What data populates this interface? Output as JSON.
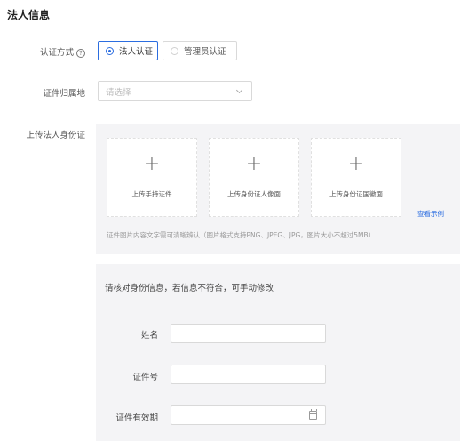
{
  "section": {
    "title": "法人信息"
  },
  "auth_method": {
    "label": "认证方式",
    "help_icon_glyph": "?",
    "options": [
      {
        "label": "法人认证",
        "selected": true
      },
      {
        "label": "管理员认证",
        "selected": false
      }
    ]
  },
  "id_region": {
    "label": "证件归属地",
    "placeholder": "请选择"
  },
  "id_upload": {
    "label": "上传法人身份证",
    "plus_glyph": "+",
    "cards": [
      {
        "label": "上传手持证件",
        "icon": "plus-icon"
      },
      {
        "label": "上传身份证人像面",
        "icon": "plus-icon"
      },
      {
        "label": "上传身份证国徽面",
        "icon": "plus-icon"
      }
    ],
    "example_link": "查看示例",
    "hint": "证件图片内容文字需可清晰辨认（图片格式支持PNG、JPEG、JPG，图片大小不超过5MB）"
  },
  "verify": {
    "note": "请核对身份信息，若信息不符合，可手动修改",
    "fields": [
      {
        "label": "姓名",
        "value": ""
      },
      {
        "label": "证件号",
        "value": ""
      },
      {
        "label": "证件有效期",
        "value": "",
        "icon": "calendar-icon"
      }
    ]
  },
  "colors": {
    "accent": "#2b6de0",
    "panel_bg": "#f4f4f6",
    "border": "#d9d9d9"
  }
}
